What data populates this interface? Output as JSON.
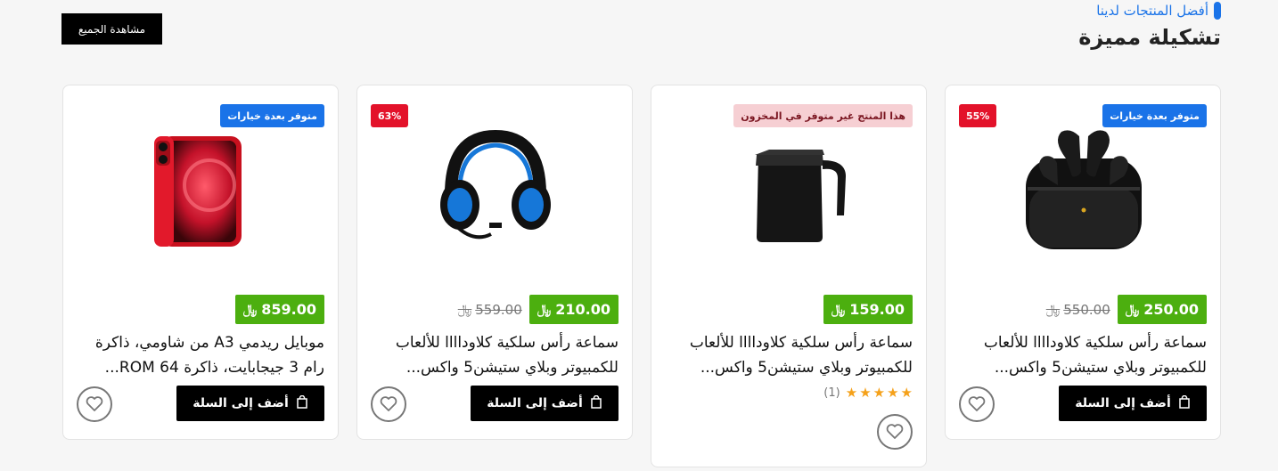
{
  "header": {
    "subtitle": "أفضل المنتجات لدينا",
    "title": "تشكيلة مميزة",
    "view_all_label": "مشاهدة الجميع"
  },
  "currency_symbol": "﷼",
  "products": [
    {
      "name": "سماعة رأس سلكية كلاوداااا للألعاب للكمبيوتر وبلاي ستيشن5 واكس...",
      "price": "250.00",
      "old_price": "550.00",
      "badges": [
        "متوفر بعدة خيارات",
        "55%"
      ],
      "add_to_cart": "أضف إلى السلة",
      "icon": "earbuds-image"
    },
    {
      "name": "سماعة رأس سلكية كلاوداااا للألعاب للكمبيوتر وبلاي ستيشن5 واكس...",
      "price": "159.00",
      "badges": [
        "هذا المنتج غير متوفر في المخزون"
      ],
      "rating": {
        "stars": 5,
        "count": "(1)"
      },
      "icon": "kettle-image"
    },
    {
      "name": "سماعة رأس سلكية كلاوداااا للألعاب للكمبيوتر وبلاي ستيشن5 واكس...",
      "price": "210.00",
      "old_price": "559.00",
      "badges": [
        "63%"
      ],
      "add_to_cart": "أضف إلى السلة",
      "icon": "headset-image"
    },
    {
      "name": "موبايل ريدمي A3 من شاومي، ذاكرة رام 3 جيجابايت، ذاكرة ROM 64...",
      "price": "859.00",
      "badges": [
        "متوفر بعدة خيارات"
      ],
      "add_to_cart": "أضف إلى السلة",
      "icon": "phone-image"
    }
  ],
  "colors": {
    "accent": "#1a73e8",
    "price": "#4caf0f",
    "sale": "#e3122a",
    "star": "#f5a11a"
  }
}
